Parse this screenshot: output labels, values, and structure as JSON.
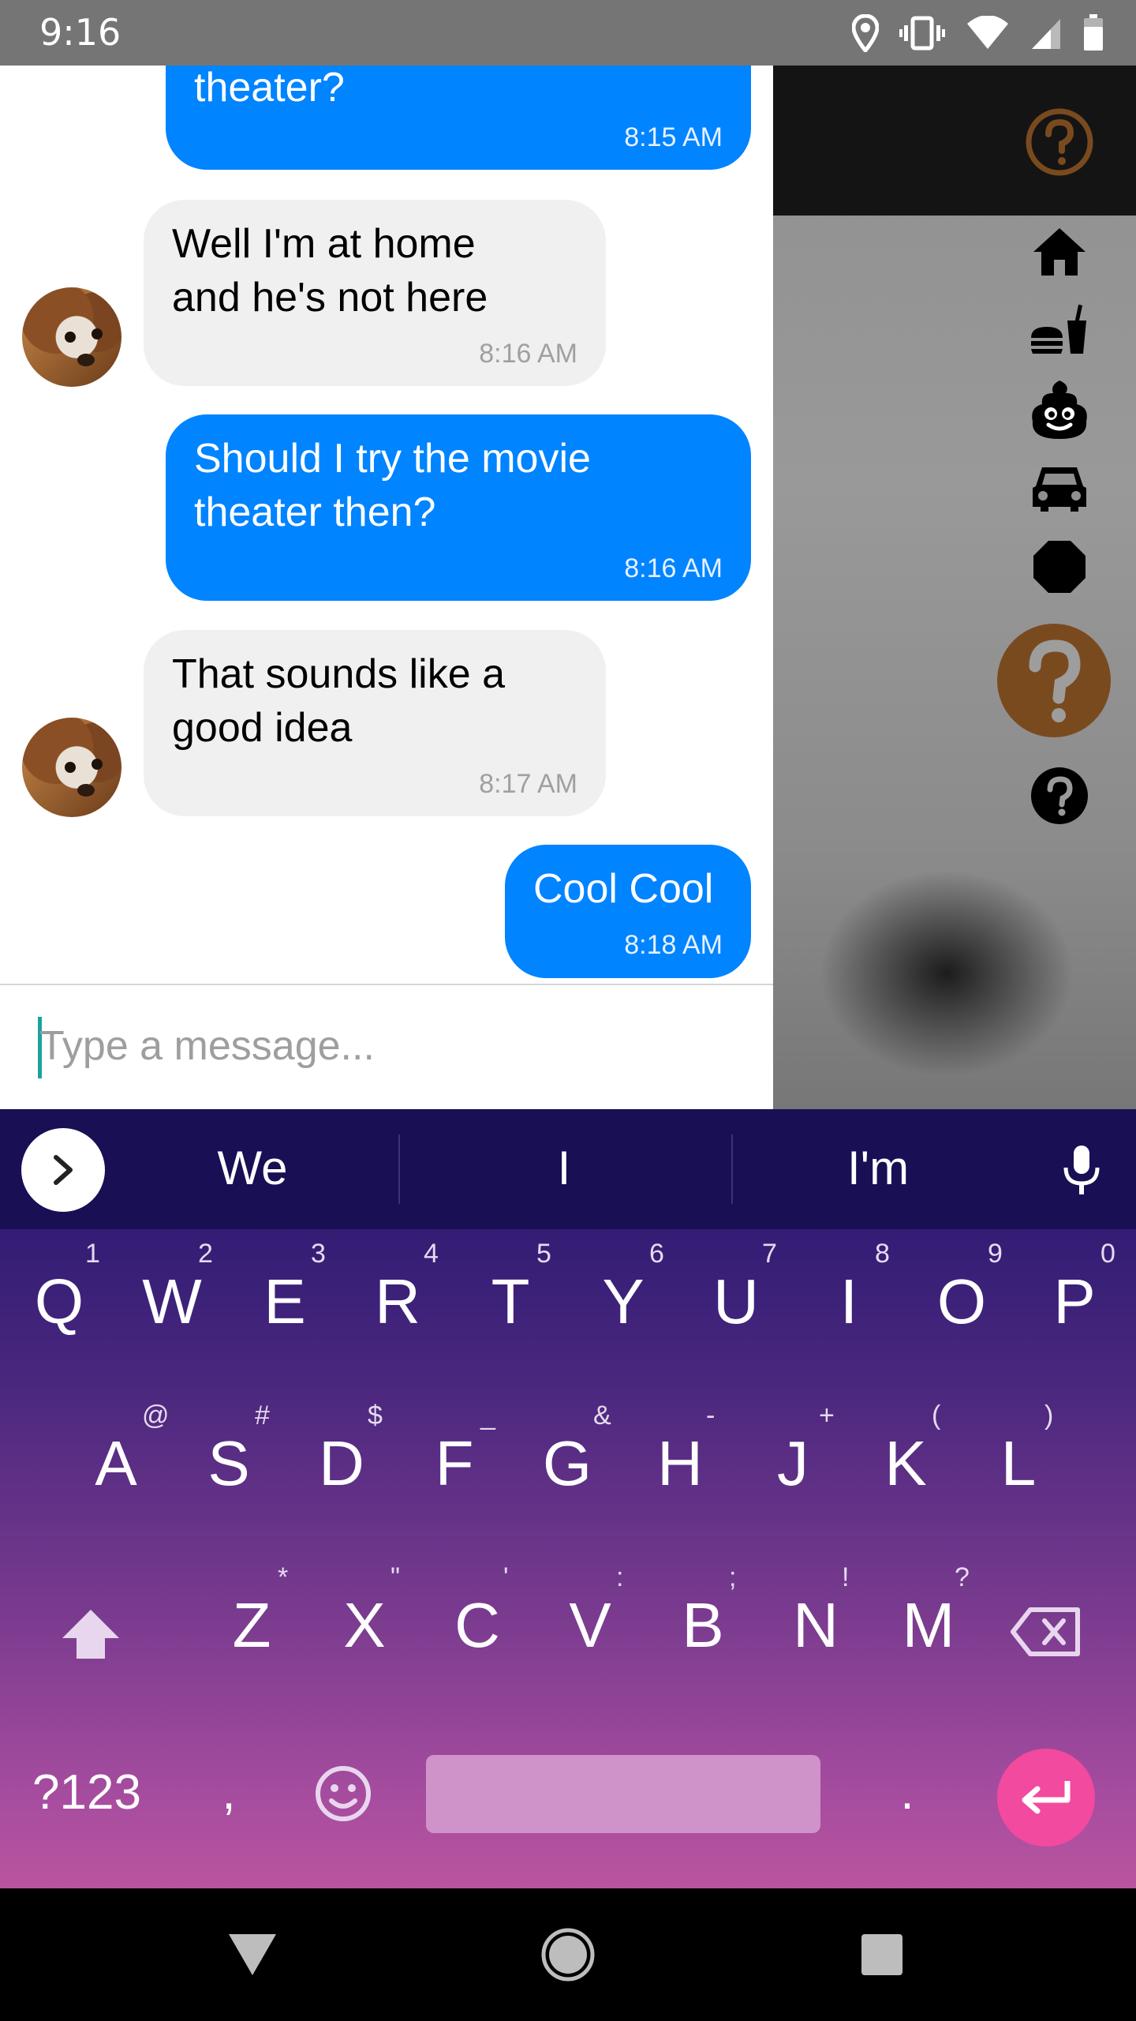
{
  "status_bar": {
    "time": "9:16"
  },
  "messages": [
    {
      "dir": "out",
      "text": "theater?",
      "time": "8:15 AM"
    },
    {
      "dir": "in",
      "text": "Well I'm at home\nand he's not here",
      "time": "8:16 AM"
    },
    {
      "dir": "out",
      "text": "Should I try the movie\ntheater then?",
      "time": "8:16 AM"
    },
    {
      "dir": "in",
      "text": "That sounds like a\ngood idea",
      "time": "8:17 AM"
    },
    {
      "dir": "out",
      "text": "Cool Cool",
      "time": "8:18 AM"
    }
  ],
  "composer": {
    "placeholder": "Type a message..."
  },
  "drawer": {
    "icons": [
      "help-circle-outline-icon",
      "home-icon",
      "food-icon",
      "poop-icon",
      "car-icon",
      "stop-octagon-icon",
      "help-circle-large-icon",
      "help-circle-icon"
    ],
    "accent_color": "#7a4a1f"
  },
  "keyboard": {
    "suggestions": [
      "We",
      "I",
      "I'm"
    ],
    "rows": [
      [
        [
          "Q",
          "1"
        ],
        [
          "W",
          "2"
        ],
        [
          "E",
          "3"
        ],
        [
          "R",
          "4"
        ],
        [
          "T",
          "5"
        ],
        [
          "Y",
          "6"
        ],
        [
          "U",
          "7"
        ],
        [
          "I",
          "8"
        ],
        [
          "O",
          "9"
        ],
        [
          "P",
          "0"
        ]
      ],
      [
        [
          "A",
          "@"
        ],
        [
          "S",
          "#"
        ],
        [
          "D",
          "$"
        ],
        [
          "F",
          "_"
        ],
        [
          "G",
          "&"
        ],
        [
          "H",
          "-"
        ],
        [
          "J",
          "+"
        ],
        [
          "K",
          "("
        ],
        [
          "L",
          ")"
        ]
      ],
      [
        [
          "Z",
          "*"
        ],
        [
          "X",
          "\""
        ],
        [
          "C",
          "'"
        ],
        [
          "V",
          ":"
        ],
        [
          "B",
          ";"
        ],
        [
          "N",
          "!"
        ],
        [
          "M",
          "?"
        ]
      ]
    ],
    "symbols_label": "?123",
    "comma_label": ",",
    "period_label": "."
  }
}
